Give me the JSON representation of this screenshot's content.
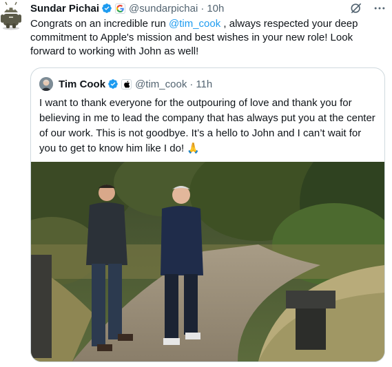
{
  "tweet": {
    "author_name": "Sundar Pichai",
    "handle": "@sundarpichai",
    "separator": "·",
    "time": "10h",
    "text_before": "Congrats on an incredible run ",
    "mention": "@tim_cook",
    "text_after": " , always respected your deep commitment to Apple's mission and best wishes in your new role! Look forward to working with John as well!",
    "affiliation_icon": "google-logo-icon"
  },
  "quote": {
    "author_name": "Tim Cook",
    "handle": "@tim_cook",
    "separator": "·",
    "time": "11h",
    "text": "I want to thank everyone for the outpouring of love and thank you for believing in me to lead the company that has always put you at the center of our work. This is not goodbye. It’s a hello to John and I can’t wait for you to get to know him like I do! 🙏",
    "affiliation_icon": "apple-logo-icon"
  },
  "colors": {
    "text": "#0f1419",
    "secondary": "#536471",
    "link": "#1d9bf0",
    "verified": "#1d9bf0",
    "border": "#cfd9de"
  }
}
